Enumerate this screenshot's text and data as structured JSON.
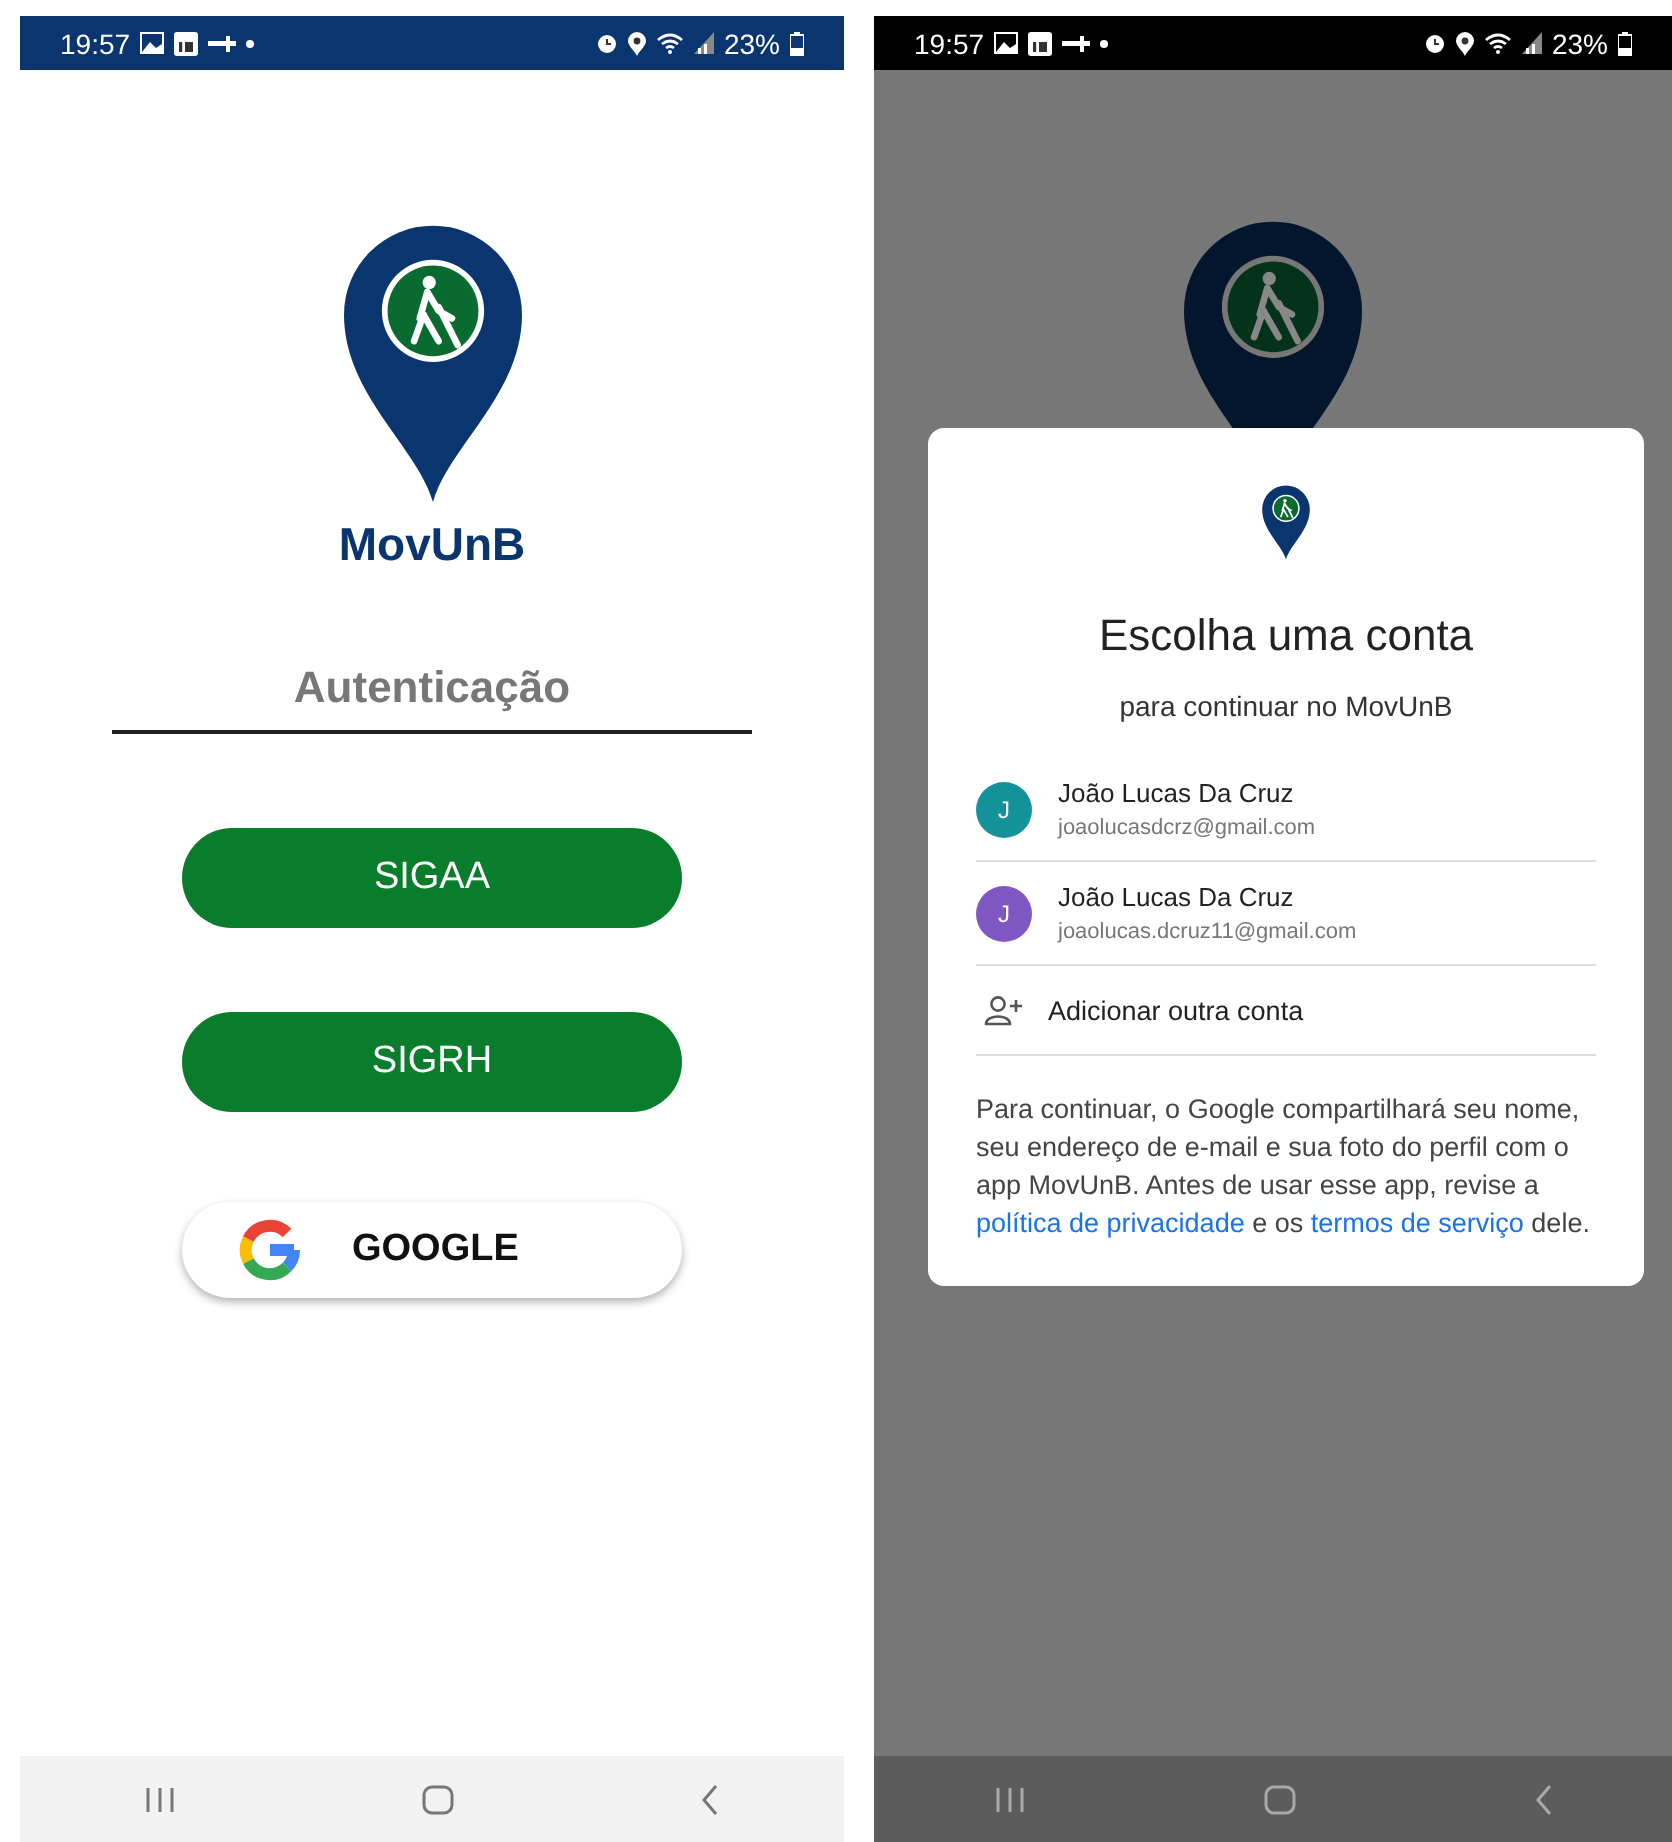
{
  "screens": [
    {
      "kind": "login",
      "status_bar": {
        "time": "19:57",
        "battery": "23%"
      },
      "app_name": "MovUnB",
      "heading": "Autenticação",
      "buttons": [
        {
          "label": "SIGAA",
          "kind": "filled"
        },
        {
          "label": "SIGRH",
          "kind": "filled"
        },
        {
          "label": "GOOGLE",
          "kind": "google"
        }
      ]
    },
    {
      "kind": "account_chooser",
      "status_bar": {
        "time": "19:57",
        "battery": "23%"
      },
      "dialog": {
        "title": "Escolha uma conta",
        "subtitle": "para continuar no MovUnB",
        "accounts": [
          {
            "name": "João Lucas Da Cruz",
            "email": "joaolucasdcrz@gmail.com",
            "initial": "J",
            "color": "#14929a"
          },
          {
            "name": "João Lucas Da Cruz",
            "email": "joaolucas.dcruz11@gmail.com",
            "initial": "J",
            "color": "#7e57c2"
          }
        ],
        "add_account": "Adicionar outra conta",
        "notice": [
          {
            "kind": "text",
            "text": "Para continuar, o Google compartilhará seu nome, seu endereço de e-mail e sua foto do perfil com o app MovUnB. Antes de usar esse app, revise a "
          },
          {
            "kind": "link",
            "text": "política de privacidade"
          },
          {
            "kind": "text",
            "text": " e os "
          },
          {
            "kind": "link",
            "text": "termos de serviço"
          },
          {
            "kind": "text",
            "text": " dele."
          }
        ]
      }
    }
  ]
}
